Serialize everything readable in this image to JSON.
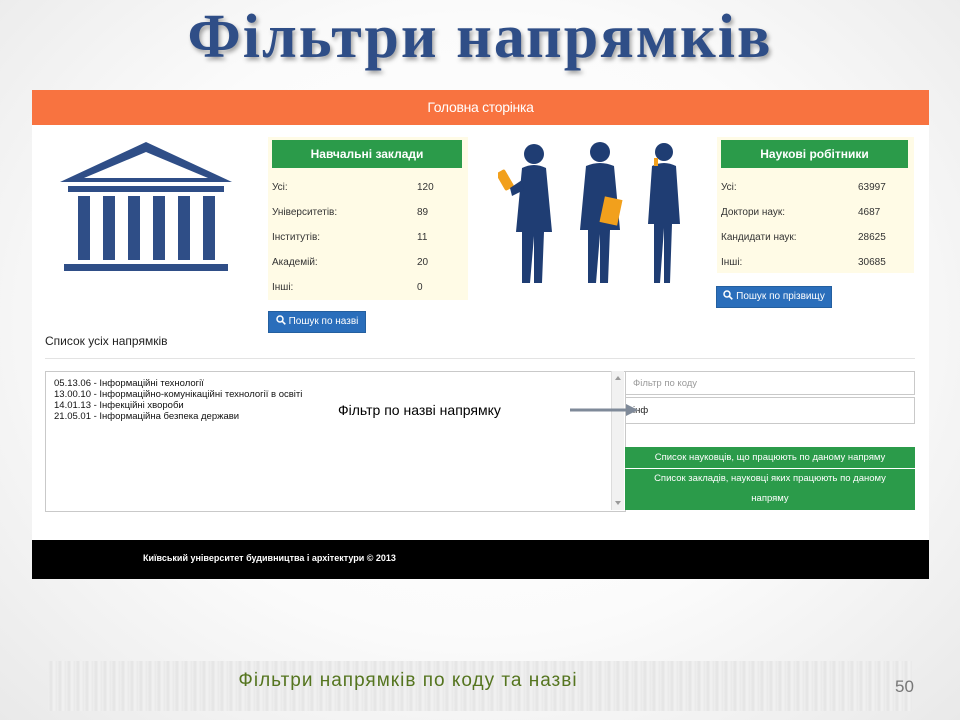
{
  "slide": {
    "title": "Фільтри напрямків",
    "subtitle": "Фільтри напрямків по коду та назві",
    "page_number": "50"
  },
  "app": {
    "header_title": "Головна сторінка",
    "institutions": {
      "title": "Навчальні заклади",
      "rows": [
        {
          "label": "Усі:",
          "value": "120"
        },
        {
          "label": "Університетів:",
          "value": "89"
        },
        {
          "label": "Інститутів:",
          "value": "11"
        },
        {
          "label": "Академій:",
          "value": "20"
        },
        {
          "label": "Інші:",
          "value": "0"
        }
      ],
      "button_label": "Пошук по назві"
    },
    "scientists": {
      "title": "Наукові робітники",
      "rows": [
        {
          "label": "Усі:",
          "value": "63997"
        },
        {
          "label": "Доктори наук:",
          "value": "4687"
        },
        {
          "label": "Кандидати наук:",
          "value": "28625"
        },
        {
          "label": "Інші:",
          "value": "30685"
        }
      ],
      "button_label": "Пошук по прізвищу"
    },
    "directions": {
      "title": "Список усіх напрямків",
      "items": [
        "05.13.06 - Інформаційні технології",
        "13.00.10 - Інформаційно-комунікаційні технології в освіті",
        "14.01.13 - Інфекційні хвороби",
        "21.05.01 - Інформаційна безпека держави"
      ],
      "code_filter_placeholder": "Фільтр по коду",
      "name_filter_value": "інф",
      "btn_scientists": "Список науковців, що працюють по даному напряму",
      "btn_institutions": "Список закладів, науковці яких працюють по даному напряму"
    },
    "annotation": "Фільтр по назві напрямку",
    "footer": "Київський університет будивництва і архітектури © 2013"
  },
  "colors": {
    "header": "#f87340",
    "green": "#2b9b4a",
    "blue_button": "#2a6ebb",
    "logo_blue": "#2f4e87",
    "card_bg": "#fffbe6"
  },
  "icons": [
    "building-columns-icon",
    "business-people-illustration",
    "search-icon",
    "arrow-icon"
  ]
}
